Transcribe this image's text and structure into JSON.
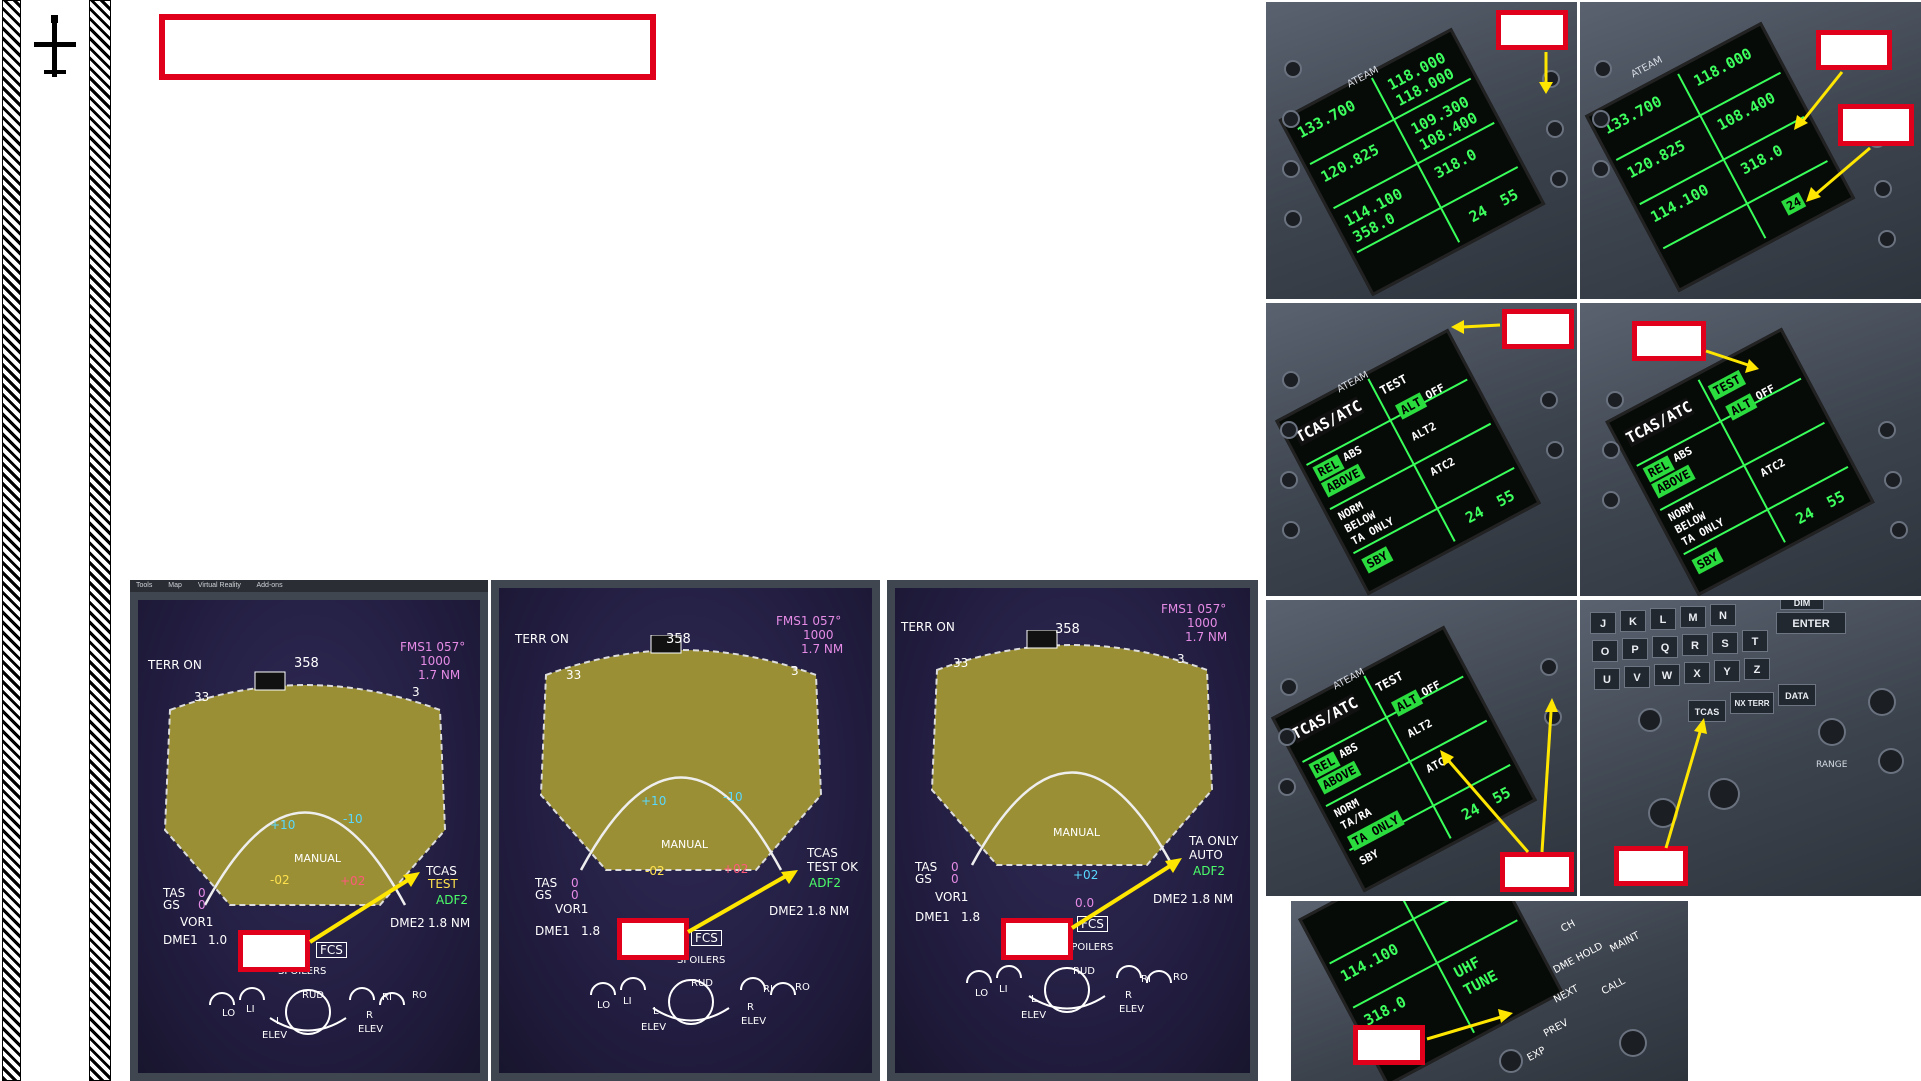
{
  "logo": {
    "icon": "aircraft-icon"
  },
  "nd_panels": [
    {
      "menu": [
        "Tools",
        "Map",
        "Virtual Reality",
        "Add-ons"
      ],
      "terr": "TERR ON",
      "heading": "358",
      "fms_line1": "FMS1 057°",
      "fms_line2": "1000",
      "fms_line3": "1.7 NM",
      "tcas_line1": "TCAS",
      "tcas_line2": "TEST",
      "adf": "ADF2",
      "tas": "TAS",
      "gs": "GS",
      "tas_val": "0",
      "gs_val": "0",
      "vor": "VOR1",
      "dme1": "DME1",
      "dme1_val": "1.0",
      "dme2": "DME2",
      "dme2_val": "1.8 NM",
      "manual": "MANUAL",
      "fcs": "FCS",
      "spoilers": "SPOILERS",
      "rud": "RUD",
      "lo": "LO",
      "li": "LI",
      "ri": "RI",
      "ro": "RO",
      "elev": "ELEV",
      "l": "L",
      "r": "R",
      "traffic_a": "+10",
      "traffic_b": "-10",
      "traffic_c": "-02",
      "traffic_d": "+02",
      "scale": "33",
      "scale_b": "3"
    },
    {
      "menu": [],
      "terr": "TERR ON",
      "heading": "358",
      "fms_line1": "FMS1 057°",
      "fms_line2": "1000",
      "fms_line3": "1.7 NM",
      "tcas_line1": "TCAS",
      "tcas_line2": "TEST OK",
      "adf": "ADF2",
      "tas": "TAS",
      "gs": "GS",
      "tas_val": "0",
      "gs_val": "0",
      "vor": "VOR1",
      "dme1": "DME1",
      "dme1_val": "1.8",
      "dme2": "DME2",
      "dme2_val": "1.8 NM",
      "manual": "MANUAL",
      "fcs": "FCS",
      "spoilers": "SPOILERS",
      "rud": "RUD",
      "lo": "LO",
      "li": "LI",
      "ri": "RI",
      "ro": "RO",
      "elev": "ELEV",
      "l": "L",
      "r": "R",
      "traffic_a": "+10",
      "traffic_b": "-10",
      "traffic_c": "-02",
      "traffic_d": "+02",
      "scale": "33",
      "scale_b": "3"
    },
    {
      "menu": [],
      "terr": "TERR ON",
      "heading": "358",
      "fms_line1": "FMS1 057°",
      "fms_line2": "1000",
      "fms_line3": "1.7 NM",
      "tcas_line1": "TA ONLY",
      "tcas_line2": "AUTO",
      "adf": "ADF2",
      "tas": "TAS",
      "gs": "GS",
      "tas_val": "0",
      "gs_val": "0",
      "vor": "VOR1",
      "dme1": "DME1",
      "dme1_val": "1.8",
      "dme2": "DME2",
      "dme2_val": "1.8 NM",
      "manual": "MANUAL",
      "fcs": "FCS",
      "spoilers": "SPOILERS",
      "rud": "RUD",
      "lo": "LO",
      "li": "LI",
      "ri": "RI",
      "ro": "RO",
      "elev": "ELEV",
      "l": "L",
      "r": "R",
      "traffic_a": "+02",
      "traffic_b": "",
      "traffic_c": "",
      "traffic_d": "0.0",
      "scale": "33",
      "scale_b": "3"
    }
  ],
  "rmu": {
    "freq_1": "118.000",
    "freq_2": "133.700",
    "freq_3": "118.000",
    "freq_4": "120.825",
    "freq_5": "109.300",
    "freq_6": "108.400",
    "freq_7": "114.100",
    "freq_8": "358.0",
    "freq_9": "318.0",
    "freq_10": "24",
    "freq_11": "55",
    "tcas_title": "TCAS/ATC",
    "test": "TEST",
    "rel": "REL",
    "abs": "ABS",
    "above": "ABOVE",
    "norm": "NORM",
    "below": "BELOW",
    "ta_ra": "TA/RA",
    "ta_only": "TA ONLY",
    "sby": "SBY",
    "atc2": "ATC2",
    "alt2": "ALT2",
    "off": "OFF",
    "alt": "ALT",
    "uhf": "UHF",
    "tune": "TUNE",
    "ch": "CH",
    "dme_hold": "DME HOLD",
    "next": "NEXT",
    "prev": "PREV",
    "exp": "EXP",
    "call": "CALL",
    "maint": "MAINT",
    "hold": "HOLD",
    "brand": "ATEAM"
  },
  "keypad": {
    "keys": [
      "J",
      "K",
      "L",
      "M",
      "N",
      "O",
      "P",
      "Q",
      "R",
      "S",
      "T",
      "U",
      "V",
      "W",
      "X",
      "Y",
      "Z"
    ],
    "enter": "ENTER",
    "tcas_btn": "TCAS",
    "nx_terr": "NX TERR",
    "data": "DATA",
    "dim": "DIM",
    "range": "RANGE"
  }
}
